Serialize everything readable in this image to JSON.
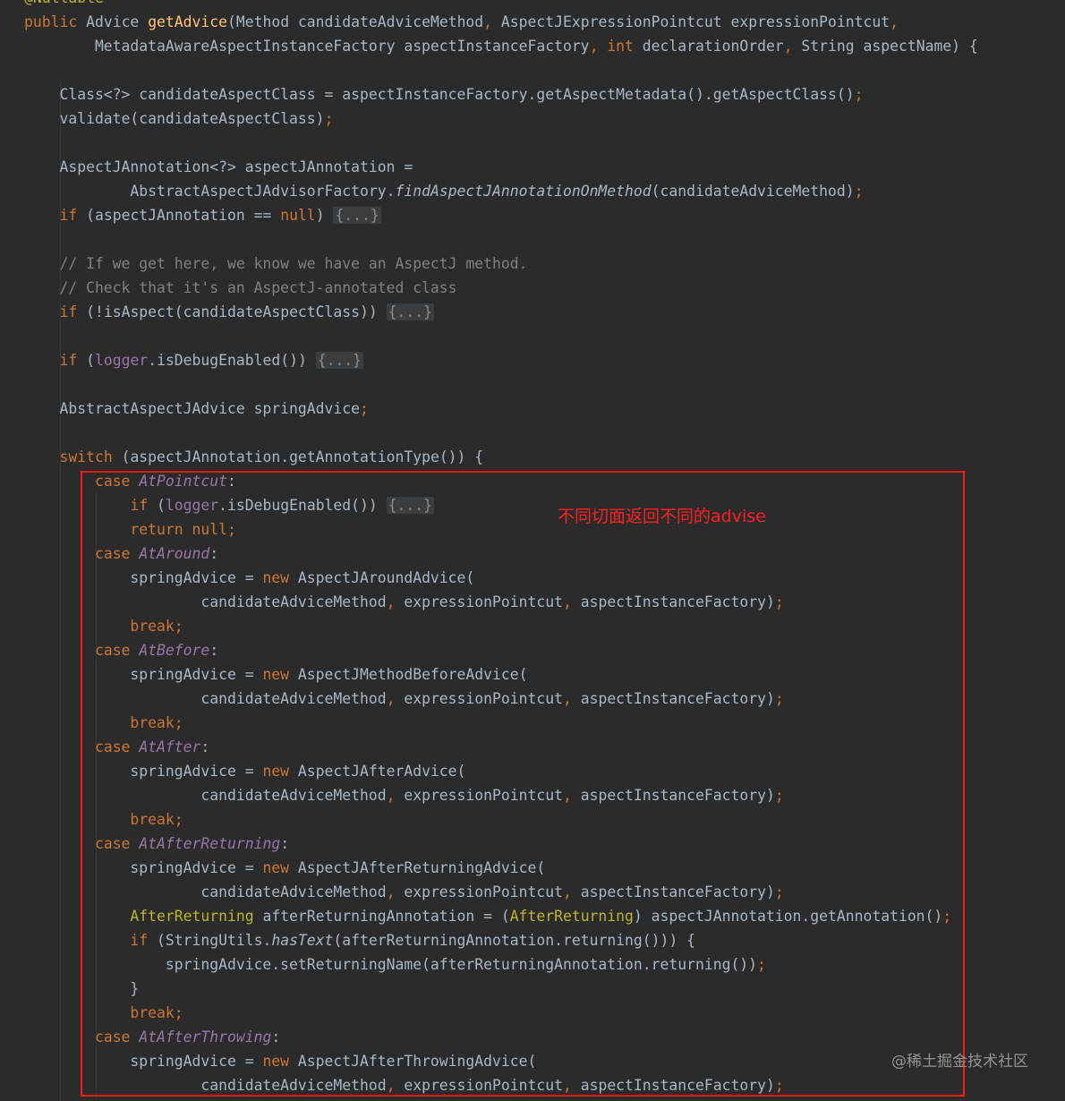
{
  "editor": {
    "lines": [
      [
        [
          "@Nullable",
          "ann"
        ]
      ],
      [
        [
          "public",
          "kw"
        ],
        [
          " ",
          ""
        ],
        [
          "Advice",
          ""
        ],
        [
          " ",
          ""
        ],
        [
          "getAdvice",
          "fn"
        ],
        [
          "(Method candidateAdviceMethod",
          ""
        ],
        [
          ",",
          "punc"
        ],
        [
          " AspectJExpressionPointcut expressionPointcut",
          ""
        ],
        [
          ",",
          "punc"
        ]
      ],
      [
        [
          "        MetadataAwareAspectInstanceFactory aspectInstanceFactory",
          ""
        ],
        [
          ",",
          "punc"
        ],
        [
          " ",
          ""
        ],
        [
          "int",
          "kw"
        ],
        [
          " declarationOrder",
          ""
        ],
        [
          ",",
          "punc"
        ],
        [
          " String aspectName) {",
          ""
        ]
      ],
      [],
      [
        [
          "    Class<?> candidateAspectClass = aspectInstanceFactory.getAspectMetadata().getAspectClass()",
          ""
        ],
        [
          ";",
          "punc"
        ]
      ],
      [
        [
          "    validate(candidateAspectClass)",
          ""
        ],
        [
          ";",
          "punc"
        ]
      ],
      [],
      [
        [
          "    AspectJAnnotation<?> aspectJAnnotation =",
          ""
        ]
      ],
      [
        [
          "            AbstractAspectJAdvisorFactory.",
          ""
        ],
        [
          "findAspectJAnnotationOnMethod",
          "ital"
        ],
        [
          "(candidateAdviceMethod)",
          ""
        ],
        [
          ";",
          "punc"
        ]
      ],
      [
        [
          "    ",
          ""
        ],
        [
          "if",
          "kw"
        ],
        [
          " (aspectJAnnotation == ",
          ""
        ],
        [
          "null",
          "kw"
        ],
        [
          ") ",
          ""
        ],
        [
          "{...}",
          "fold"
        ]
      ],
      [],
      [
        [
          "    // If we get here, we know we have an AspectJ method.",
          "cmt"
        ]
      ],
      [
        [
          "    // Check that it's an AspectJ-annotated class",
          "cmt"
        ]
      ],
      [
        [
          "    ",
          ""
        ],
        [
          "if",
          "kw"
        ],
        [
          " (!isAspect(candidateAspectClass)) ",
          ""
        ],
        [
          "{...}",
          "fold"
        ]
      ],
      [],
      [
        [
          "    ",
          ""
        ],
        [
          "if",
          "kw"
        ],
        [
          " (",
          ""
        ],
        [
          "logger",
          "fld"
        ],
        [
          ".isDebugEnabled()) ",
          ""
        ],
        [
          "{...}",
          "fold"
        ]
      ],
      [],
      [
        [
          "    AbstractAspectJAdvice springAdvice",
          ""
        ],
        [
          ";",
          "punc"
        ]
      ],
      [],
      [
        [
          "    ",
          ""
        ],
        [
          "switch",
          "kw"
        ],
        [
          " (aspectJAnnotation.getAnnotationType()) {",
          ""
        ]
      ],
      [
        [
          "        ",
          ""
        ],
        [
          "case",
          "kw"
        ],
        [
          " ",
          ""
        ],
        [
          "AtPointcut",
          "enumc"
        ],
        [
          ":",
          ""
        ]
      ],
      [
        [
          "            ",
          ""
        ],
        [
          "if",
          "kw"
        ],
        [
          " (",
          ""
        ],
        [
          "logger",
          "fld"
        ],
        [
          ".isDebugEnabled()) ",
          ""
        ],
        [
          "{...}",
          "fold"
        ]
      ],
      [
        [
          "            ",
          ""
        ],
        [
          "return null;",
          "kw"
        ]
      ],
      [
        [
          "        ",
          ""
        ],
        [
          "case",
          "kw"
        ],
        [
          " ",
          ""
        ],
        [
          "AtAround",
          "enumc"
        ],
        [
          ":",
          ""
        ]
      ],
      [
        [
          "            springAdvice = ",
          ""
        ],
        [
          "new",
          "kw"
        ],
        [
          " AspectJAroundAdvice(",
          ""
        ]
      ],
      [
        [
          "                    candidateAdviceMethod",
          ""
        ],
        [
          ",",
          "punc"
        ],
        [
          " expressionPointcut",
          ""
        ],
        [
          ",",
          "punc"
        ],
        [
          " aspectInstanceFactory)",
          ""
        ],
        [
          ";",
          "punc"
        ]
      ],
      [
        [
          "            ",
          ""
        ],
        [
          "break;",
          "kw"
        ]
      ],
      [
        [
          "        ",
          ""
        ],
        [
          "case",
          "kw"
        ],
        [
          " ",
          ""
        ],
        [
          "AtBefore",
          "enumc"
        ],
        [
          ":",
          ""
        ]
      ],
      [
        [
          "            springAdvice = ",
          ""
        ],
        [
          "new",
          "kw"
        ],
        [
          " AspectJMethodBeforeAdvice(",
          ""
        ]
      ],
      [
        [
          "                    candidateAdviceMethod",
          ""
        ],
        [
          ",",
          "punc"
        ],
        [
          " expressionPointcut",
          ""
        ],
        [
          ",",
          "punc"
        ],
        [
          " aspectInstanceFactory)",
          ""
        ],
        [
          ";",
          "punc"
        ]
      ],
      [
        [
          "            ",
          ""
        ],
        [
          "break;",
          "kw"
        ]
      ],
      [
        [
          "        ",
          ""
        ],
        [
          "case",
          "kw"
        ],
        [
          " ",
          ""
        ],
        [
          "AtAfter",
          "enumc"
        ],
        [
          ":",
          ""
        ]
      ],
      [
        [
          "            springAdvice = ",
          ""
        ],
        [
          "new",
          "kw"
        ],
        [
          " AspectJAfterAdvice(",
          ""
        ]
      ],
      [
        [
          "                    candidateAdviceMethod",
          ""
        ],
        [
          ",",
          "punc"
        ],
        [
          " expressionPointcut",
          ""
        ],
        [
          ",",
          "punc"
        ],
        [
          " aspectInstanceFactory)",
          ""
        ],
        [
          ";",
          "punc"
        ]
      ],
      [
        [
          "            ",
          ""
        ],
        [
          "break;",
          "kw"
        ]
      ],
      [
        [
          "        ",
          ""
        ],
        [
          "case",
          "kw"
        ],
        [
          " ",
          ""
        ],
        [
          "AtAfterReturning",
          "enumc"
        ],
        [
          ":",
          ""
        ]
      ],
      [
        [
          "            springAdvice = ",
          ""
        ],
        [
          "new",
          "kw"
        ],
        [
          " AspectJAfterReturningAdvice(",
          ""
        ]
      ],
      [
        [
          "                    candidateAdviceMethod",
          ""
        ],
        [
          ",",
          "punc"
        ],
        [
          " expressionPointcut",
          ""
        ],
        [
          ",",
          "punc"
        ],
        [
          " aspectInstanceFactory)",
          ""
        ],
        [
          ";",
          "punc"
        ]
      ],
      [
        [
          "            ",
          ""
        ],
        [
          "AfterReturning",
          "itype"
        ],
        [
          " afterReturningAnnotation = (",
          ""
        ],
        [
          "AfterReturning",
          "itype"
        ],
        [
          ") aspectJAnnotation.getAnnotation()",
          ""
        ],
        [
          ";",
          "punc"
        ]
      ],
      [
        [
          "            ",
          ""
        ],
        [
          "if",
          "kw"
        ],
        [
          " (StringUtils.",
          ""
        ],
        [
          "hasText",
          "ital"
        ],
        [
          "(afterReturningAnnotation.returning())) {",
          ""
        ]
      ],
      [
        [
          "                springAdvice.setReturningName(afterReturningAnnotation.returning())",
          ""
        ],
        [
          ";",
          "punc"
        ]
      ],
      [
        [
          "            }",
          ""
        ]
      ],
      [
        [
          "            ",
          ""
        ],
        [
          "break;",
          "kw"
        ]
      ],
      [
        [
          "        ",
          ""
        ],
        [
          "case",
          "kw"
        ],
        [
          " ",
          ""
        ],
        [
          "AtAfterThrowing",
          "enumc"
        ],
        [
          ":",
          ""
        ]
      ],
      [
        [
          "            springAdvice = ",
          ""
        ],
        [
          "new",
          "kw"
        ],
        [
          " AspectJAfterThrowingAdvice(",
          ""
        ]
      ],
      [
        [
          "                    candidateAdviceMethod",
          ""
        ],
        [
          ",",
          "punc"
        ],
        [
          " expressionPointcut",
          ""
        ],
        [
          ",",
          "punc"
        ],
        [
          " aspectInstanceFactory)",
          ""
        ],
        [
          ";",
          "punc"
        ]
      ]
    ]
  },
  "annotation": {
    "callout_text": "不同切面返回不同的advise",
    "box_color": "#ff1a1a"
  },
  "watermark": {
    "text": "@稀土掘金技术社区"
  },
  "colors": {
    "background": "#2b2b2b",
    "keyword": "#cc7832",
    "method_decl": "#ffc66d",
    "annotation": "#bbb529",
    "field": "#9876aa",
    "comment": "#808080",
    "default_text": "#a9b7c6"
  }
}
